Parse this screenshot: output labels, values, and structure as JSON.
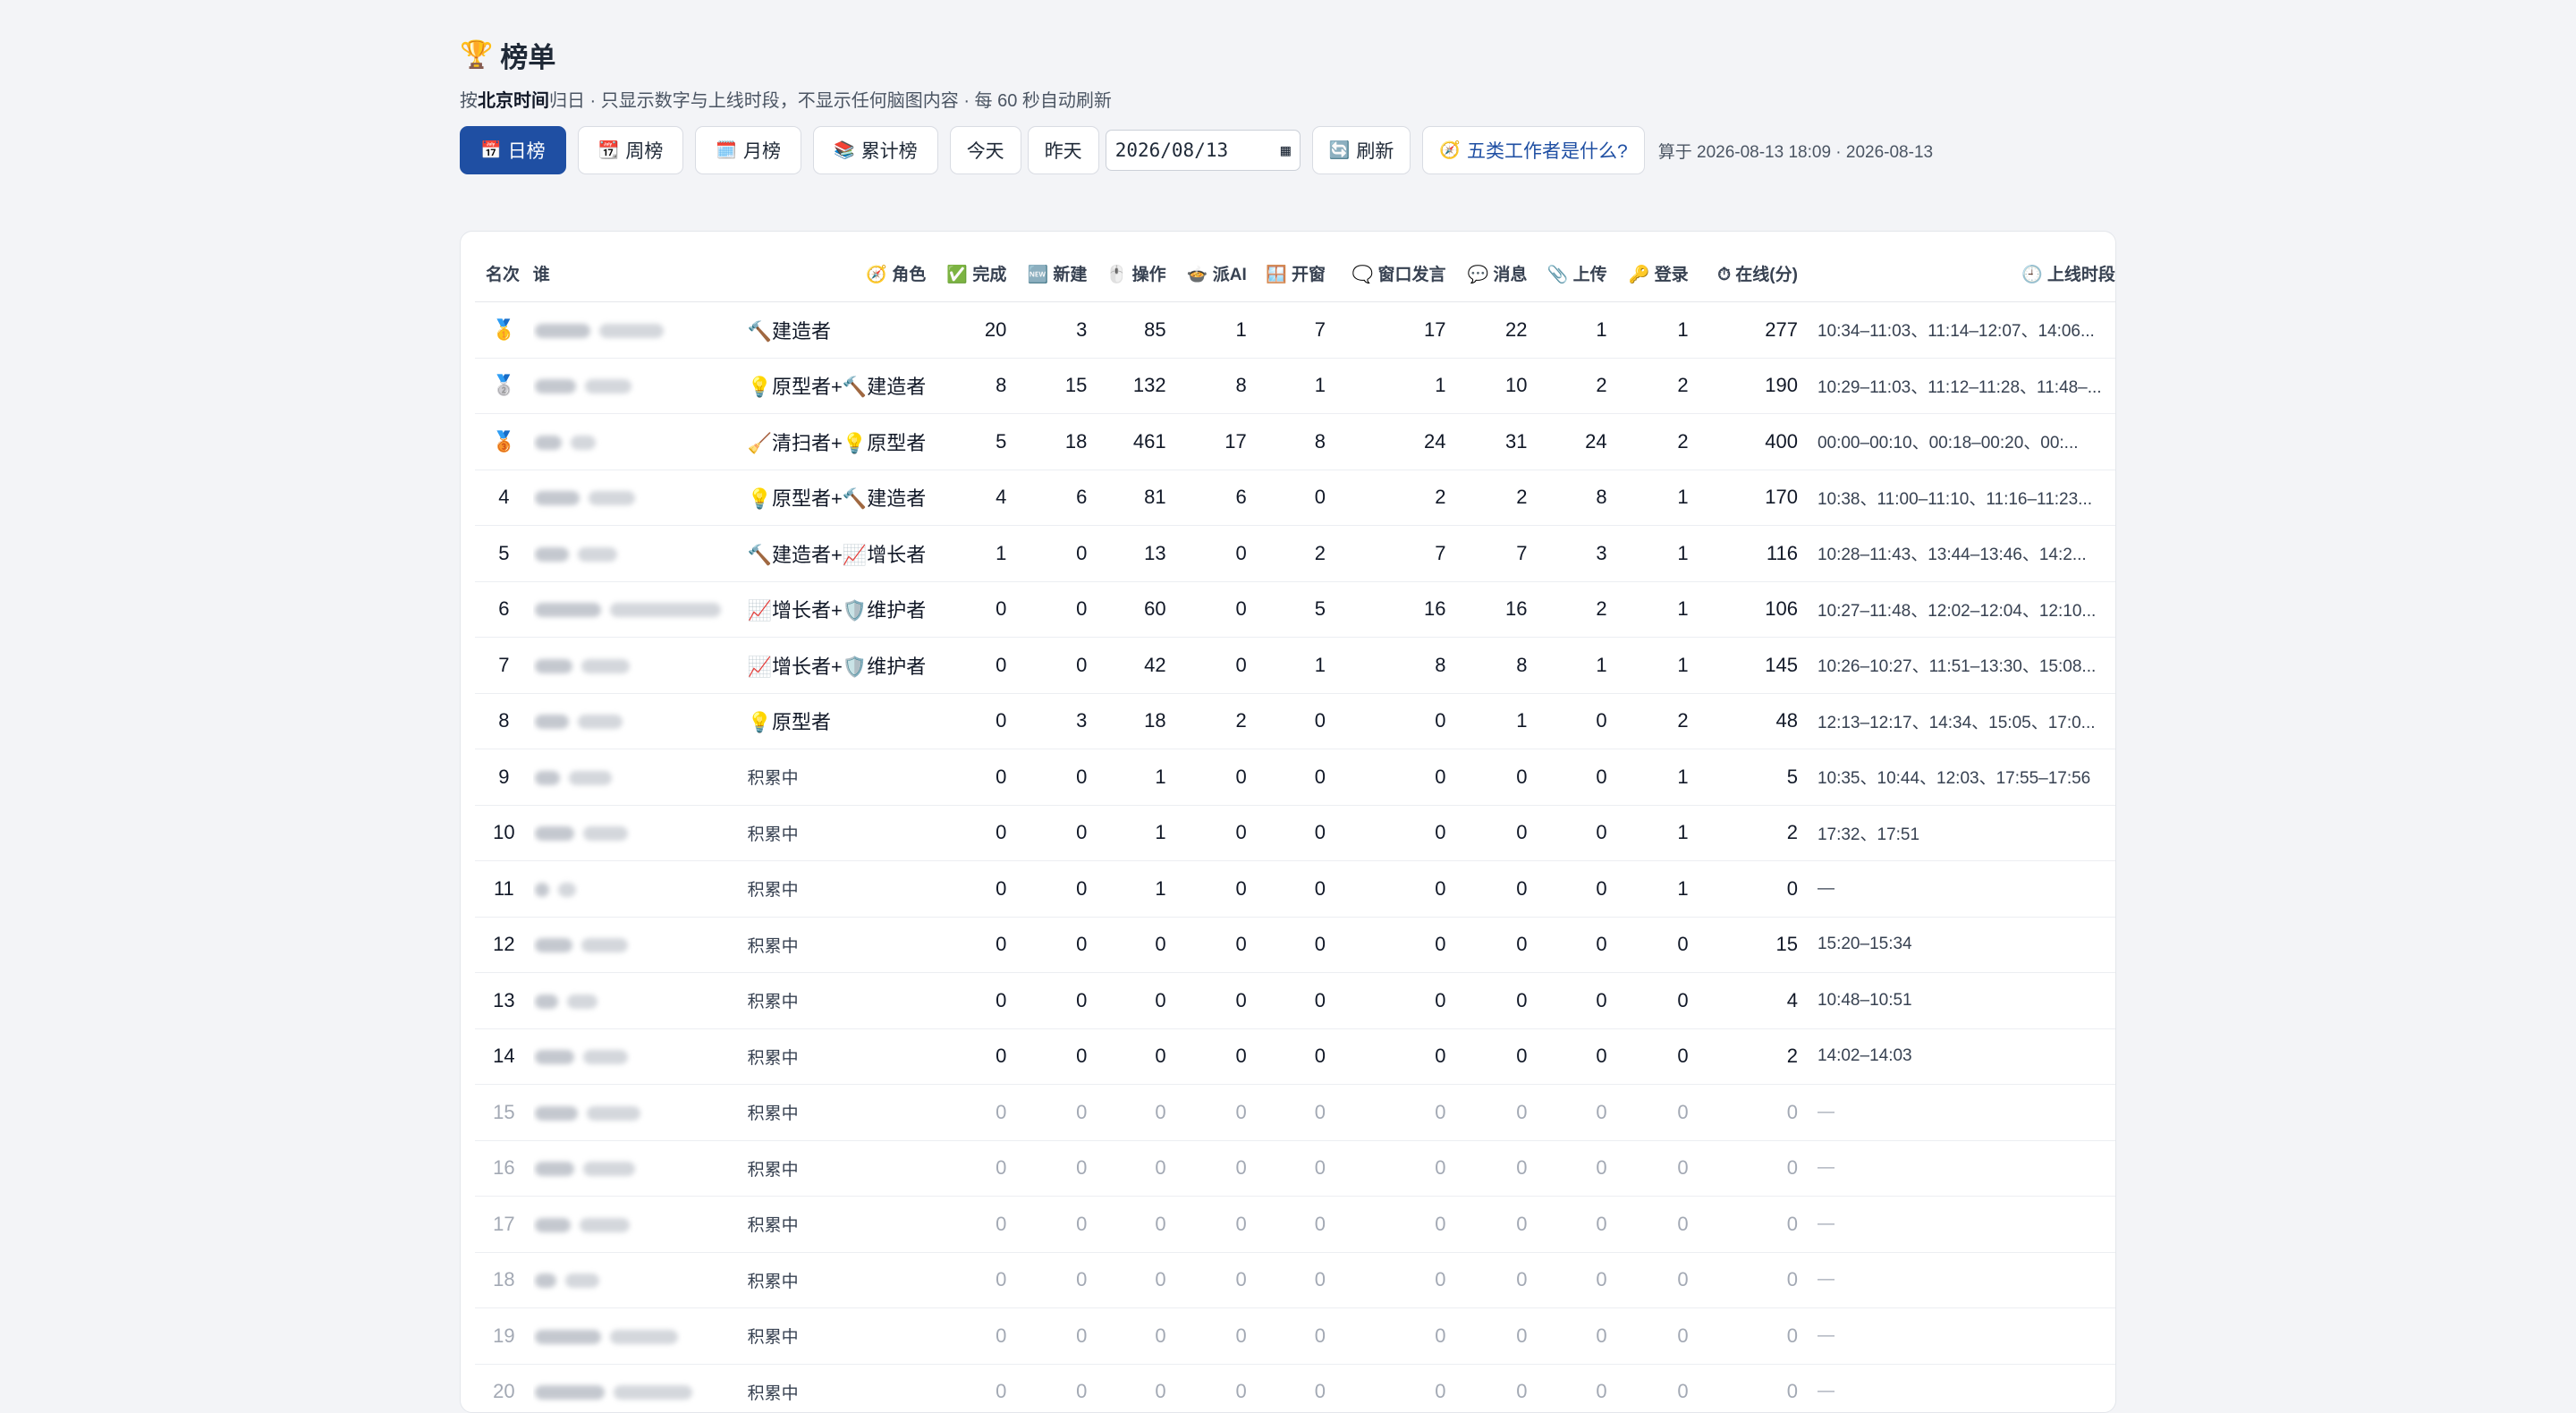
{
  "header": {
    "title_icon": "trophy-icon",
    "title": "榜单",
    "subtitle_pre": "按",
    "subtitle_bold": "北京时间",
    "subtitle_post": "归日 · 只显示数字与上线时段，不显示任何脑图内容 · 每 60 秒自动刷新"
  },
  "toolbar": {
    "tabs": [
      {
        "icon": "📅",
        "label": "日榜",
        "active": true
      },
      {
        "icon": "📆",
        "label": "周榜"
      },
      {
        "icon": "🗓️",
        "label": "月榜"
      },
      {
        "icon": "📚",
        "label": "累计榜"
      }
    ],
    "today_label": "今天",
    "yesterday_label": "昨天",
    "date_value": "2026/08/13",
    "refresh_icon": "🔄",
    "refresh_label": "刷新",
    "help_icon": "🧭",
    "help_label": "五类工作者是什么?",
    "meta": "算于 2026-08-13 18:09 · 2026-08-13"
  },
  "table": {
    "columns": {
      "rank": "名次",
      "who": "谁",
      "role": "🧭 角色",
      "done": "✅ 完成",
      "new": "🆕 新建",
      "ops": "🖱️ 操作",
      "ai": "🍲 派AI",
      "win": "🪟 开窗",
      "speak": "🗨️ 窗口发言",
      "msg": "💬 消息",
      "upload": "📎 上传",
      "login": "🔑 登录",
      "online": "⏱ 在线(分)",
      "times": "🕘 上线时段"
    },
    "rows": [
      {
        "rank": "🥇",
        "role": "🔨建造者",
        "done": "20",
        "new": "3",
        "ops": "85",
        "ai": "1",
        "win": "7",
        "speak": "17",
        "msg": "22",
        "upload": "1",
        "login": "1",
        "online": "277",
        "times": "10:34–11:03、11:14–12:07、14:06..."
      },
      {
        "rank": "🥈",
        "role": "💡原型者+🔨建造者",
        "done": "8",
        "new": "15",
        "ops": "132",
        "ai": "8",
        "win": "1",
        "speak": "1",
        "msg": "10",
        "upload": "2",
        "login": "2",
        "online": "190",
        "times": "10:29–11:03、11:12–11:28、11:48–..."
      },
      {
        "rank": "🥉",
        "role": "🧹清扫者+💡原型者",
        "done": "5",
        "new": "18",
        "ops": "461",
        "ai": "17",
        "win": "8",
        "speak": "24",
        "msg": "31",
        "upload": "24",
        "login": "2",
        "online": "400",
        "times": "00:00–00:10、00:18–00:20、00:..."
      },
      {
        "rank": "4",
        "role": "💡原型者+🔨建造者",
        "done": "4",
        "new": "6",
        "ops": "81",
        "ai": "6",
        "win": "0",
        "speak": "2",
        "msg": "2",
        "upload": "8",
        "login": "1",
        "online": "170",
        "times": "10:38、11:00–11:10、11:16–11:23..."
      },
      {
        "rank": "5",
        "role": "🔨建造者+📈增长者",
        "done": "1",
        "new": "0",
        "ops": "13",
        "ai": "0",
        "win": "2",
        "speak": "7",
        "msg": "7",
        "upload": "3",
        "login": "1",
        "online": "116",
        "times": "10:28–11:43、13:44–13:46、14:2..."
      },
      {
        "rank": "6",
        "role": "📈增长者+🛡️维护者",
        "done": "0",
        "new": "0",
        "ops": "60",
        "ai": "0",
        "win": "5",
        "speak": "16",
        "msg": "16",
        "upload": "2",
        "login": "1",
        "online": "106",
        "times": "10:27–11:48、12:02–12:04、12:10..."
      },
      {
        "rank": "7",
        "role": "📈增长者+🛡️维护者",
        "done": "0",
        "new": "0",
        "ops": "42",
        "ai": "0",
        "win": "1",
        "speak": "8",
        "msg": "8",
        "upload": "1",
        "login": "1",
        "online": "145",
        "times": "10:26–10:27、11:51–13:30、15:08..."
      },
      {
        "rank": "8",
        "role": "💡原型者",
        "done": "0",
        "new": "3",
        "ops": "18",
        "ai": "2",
        "win": "0",
        "speak": "0",
        "msg": "1",
        "upload": "0",
        "login": "2",
        "online": "48",
        "times": "12:13–12:17、14:34、15:05、17:0..."
      },
      {
        "rank": "9",
        "role": "积累中",
        "done": "0",
        "new": "0",
        "ops": "1",
        "ai": "0",
        "win": "0",
        "speak": "0",
        "msg": "0",
        "upload": "0",
        "login": "1",
        "online": "5",
        "times": "10:35、10:44、12:03、17:55–17:56"
      },
      {
        "rank": "10",
        "role": "积累中",
        "done": "0",
        "new": "0",
        "ops": "1",
        "ai": "0",
        "win": "0",
        "speak": "0",
        "msg": "0",
        "upload": "0",
        "login": "1",
        "online": "2",
        "times": "17:32、17:51"
      },
      {
        "rank": "11",
        "role": "积累中",
        "done": "0",
        "new": "0",
        "ops": "1",
        "ai": "0",
        "win": "0",
        "speak": "0",
        "msg": "0",
        "upload": "0",
        "login": "1",
        "online": "0",
        "times": "—"
      },
      {
        "rank": "12",
        "role": "积累中",
        "done": "0",
        "new": "0",
        "ops": "0",
        "ai": "0",
        "win": "0",
        "speak": "0",
        "msg": "0",
        "upload": "0",
        "login": "0",
        "online": "15",
        "times": "15:20–15:34"
      },
      {
        "rank": "13",
        "role": "积累中",
        "done": "0",
        "new": "0",
        "ops": "0",
        "ai": "0",
        "win": "0",
        "speak": "0",
        "msg": "0",
        "upload": "0",
        "login": "0",
        "online": "4",
        "times": "10:48–10:51"
      },
      {
        "rank": "14",
        "role": "积累中",
        "done": "0",
        "new": "0",
        "ops": "0",
        "ai": "0",
        "win": "0",
        "speak": "0",
        "msg": "0",
        "upload": "0",
        "login": "0",
        "online": "2",
        "times": "14:02–14:03"
      },
      {
        "rank": "15",
        "role": "积累中",
        "done": "0",
        "new": "0",
        "ops": "0",
        "ai": "0",
        "win": "0",
        "speak": "0",
        "msg": "0",
        "upload": "0",
        "login": "0",
        "online": "0",
        "times": "—",
        "dim": true
      },
      {
        "rank": "16",
        "role": "积累中",
        "done": "0",
        "new": "0",
        "ops": "0",
        "ai": "0",
        "win": "0",
        "speak": "0",
        "msg": "0",
        "upload": "0",
        "login": "0",
        "online": "0",
        "times": "—",
        "dim": true
      },
      {
        "rank": "17",
        "role": "积累中",
        "done": "0",
        "new": "0",
        "ops": "0",
        "ai": "0",
        "win": "0",
        "speak": "0",
        "msg": "0",
        "upload": "0",
        "login": "0",
        "online": "0",
        "times": "—",
        "dim": true
      },
      {
        "rank": "18",
        "role": "积累中",
        "done": "0",
        "new": "0",
        "ops": "0",
        "ai": "0",
        "win": "0",
        "speak": "0",
        "msg": "0",
        "upload": "0",
        "login": "0",
        "online": "0",
        "times": "—",
        "dim": true
      },
      {
        "rank": "19",
        "role": "积累中",
        "done": "0",
        "new": "0",
        "ops": "0",
        "ai": "0",
        "win": "0",
        "speak": "0",
        "msg": "0",
        "upload": "0",
        "login": "0",
        "online": "0",
        "times": "—",
        "dim": true
      },
      {
        "rank": "20",
        "role": "积累中",
        "done": "0",
        "new": "0",
        "ops": "0",
        "ai": "0",
        "win": "0",
        "speak": "0",
        "msg": "0",
        "upload": "0",
        "login": "0",
        "online": "0",
        "times": "—",
        "dim": true
      }
    ]
  }
}
